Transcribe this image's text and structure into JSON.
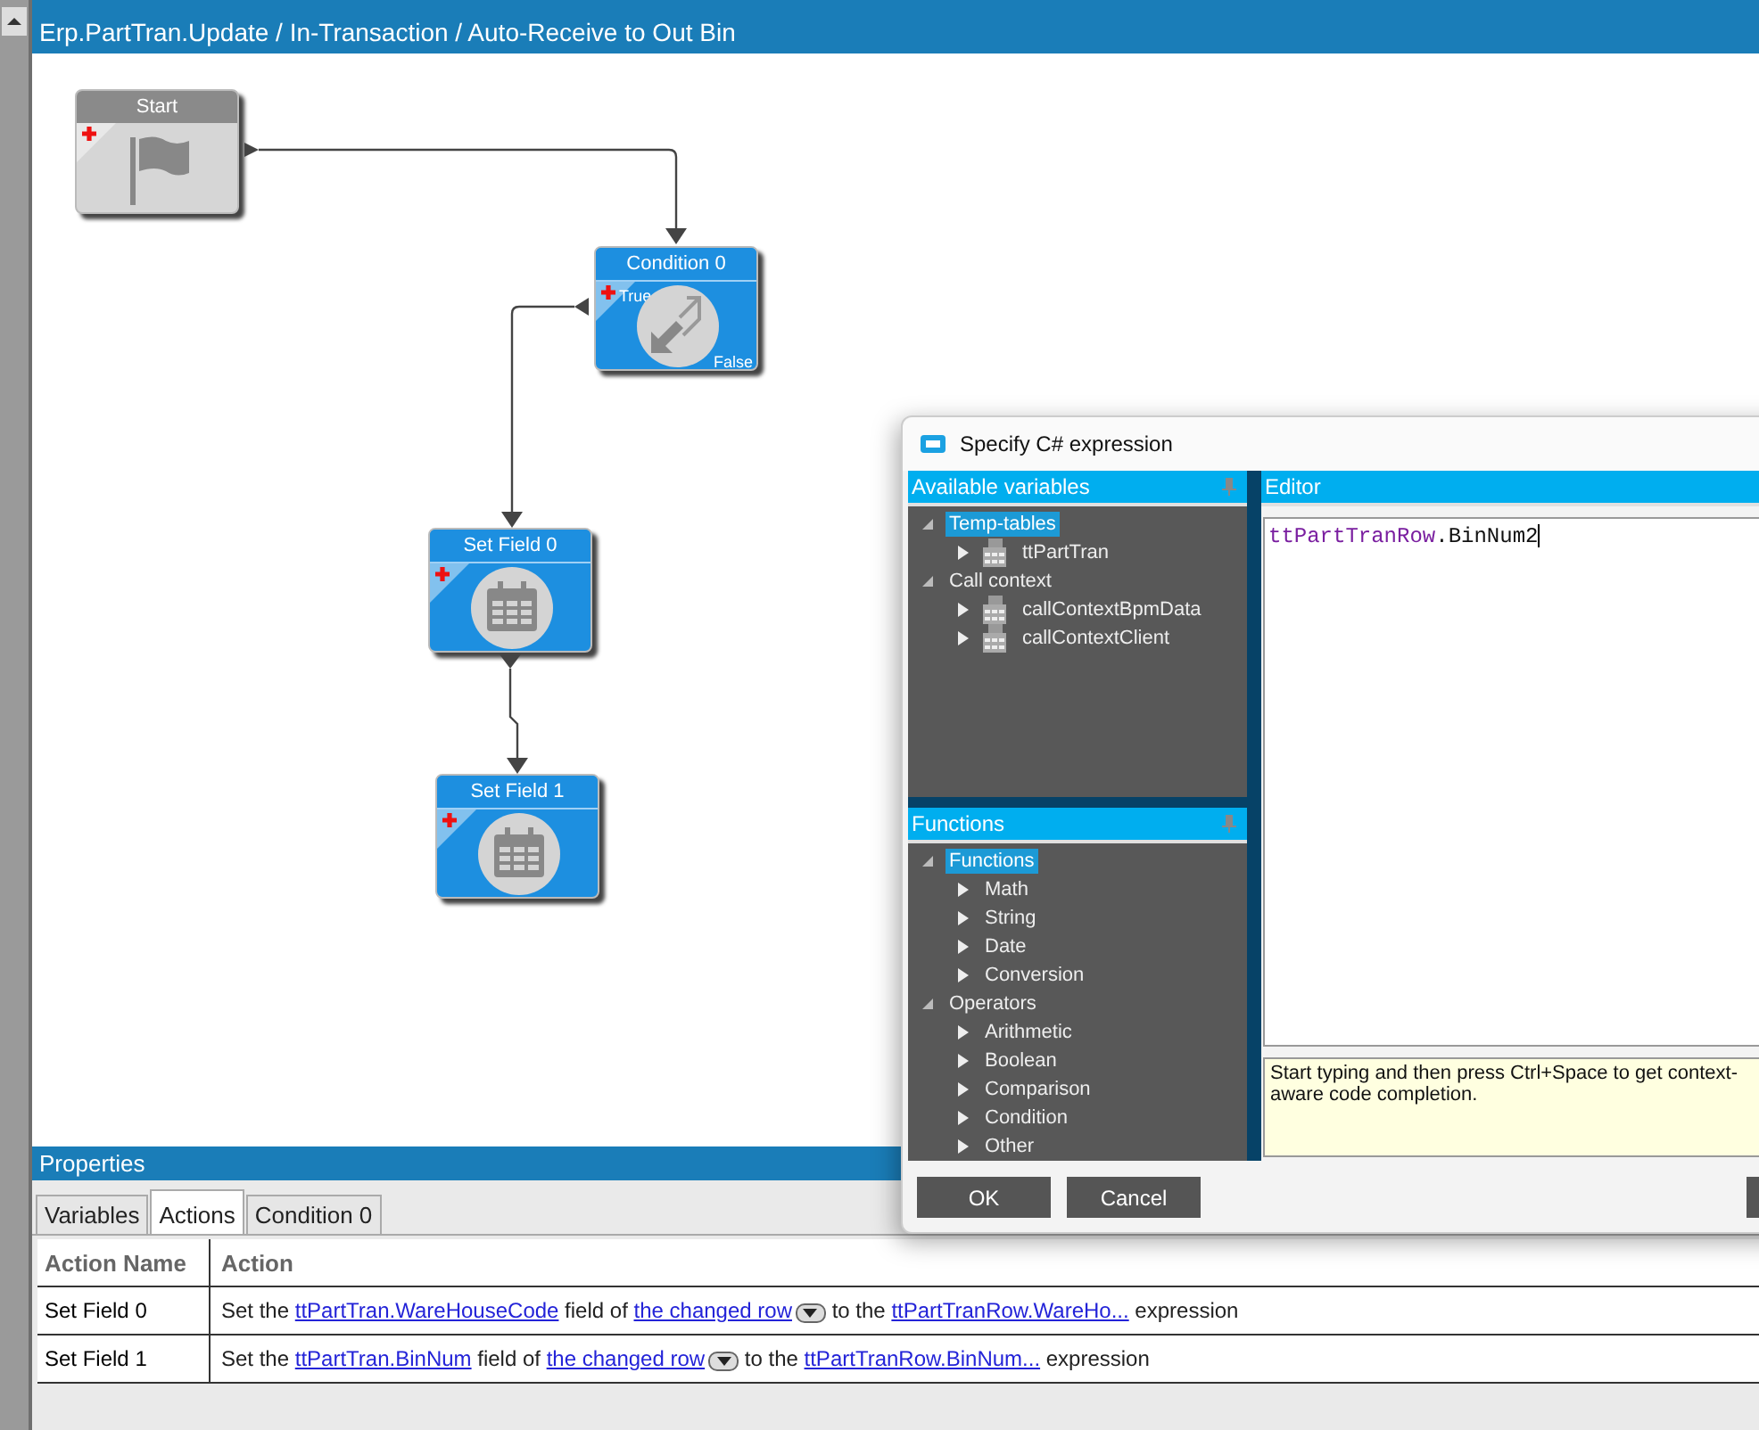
{
  "breadcrumb": "Erp.PartTran.Update / In-Transaction / Auto-Receive to Out Bin",
  "nodes": [
    {
      "kind": "start",
      "title": "Start"
    },
    {
      "kind": "condition",
      "title": "Condition 0",
      "true_label": "True",
      "false_label": "False"
    },
    {
      "kind": "set_field",
      "title": "Set Field 0"
    },
    {
      "kind": "set_field",
      "title": "Set Field 1"
    }
  ],
  "properties": {
    "title": "Properties",
    "tabs": [
      {
        "label": "Variables",
        "selected": false
      },
      {
        "label": "Actions",
        "selected": true
      },
      {
        "label": "Condition 0",
        "selected": false
      }
    ],
    "columns": [
      "Action Name",
      "Action"
    ],
    "rows": [
      {
        "name": "Set Field 0",
        "parts": [
          {
            "kind": "text",
            "text": "Set the "
          },
          {
            "kind": "link",
            "text": "ttPartTran.WareHouseCode"
          },
          {
            "kind": "text",
            "text": " field of "
          },
          {
            "kind": "link",
            "text": "the changed row"
          },
          {
            "kind": "dropdown"
          },
          {
            "kind": "text",
            "text": " to the "
          },
          {
            "kind": "link",
            "text": "ttPartTranRow.WareHo..."
          },
          {
            "kind": "text",
            "text": " expression"
          }
        ]
      },
      {
        "name": "Set Field 1",
        "parts": [
          {
            "kind": "text",
            "text": "Set the "
          },
          {
            "kind": "link",
            "text": "ttPartTran.BinNum"
          },
          {
            "kind": "text",
            "text": " field of "
          },
          {
            "kind": "link",
            "text": "the changed row"
          },
          {
            "kind": "dropdown"
          },
          {
            "kind": "text",
            "text": " to the "
          },
          {
            "kind": "link",
            "text": "ttPartTranRow.BinNum..."
          },
          {
            "kind": "text",
            "text": " expression"
          }
        ]
      }
    ]
  },
  "dialog": {
    "title": "Specify C# expression",
    "variables": {
      "title": "Available variables",
      "tree": [
        {
          "label": "Temp-tables",
          "expanded": true,
          "selected": true,
          "children": [
            {
              "label": "ttPartTran",
              "kind": "table",
              "expanded": false,
              "selected": false
            }
          ]
        },
        {
          "label": "Call context",
          "expanded": true,
          "selected": false,
          "children": [
            {
              "label": "callContextBpmData",
              "kind": "table",
              "expanded": false,
              "selected": false
            },
            {
              "label": "callContextClient",
              "kind": "table",
              "expanded": false,
              "selected": false
            }
          ]
        }
      ]
    },
    "functions": {
      "title": "Functions",
      "tree": [
        {
          "label": "Functions",
          "expanded": true,
          "selected": true,
          "children": [
            {
              "label": "Math",
              "expanded": false,
              "selected": false
            },
            {
              "label": "String",
              "expanded": false,
              "selected": false
            },
            {
              "label": "Date",
              "expanded": false,
              "selected": false
            },
            {
              "label": "Conversion",
              "expanded": false,
              "selected": false
            }
          ]
        },
        {
          "label": "Operators",
          "expanded": true,
          "selected": false,
          "children": [
            {
              "label": "Arithmetic",
              "expanded": false,
              "selected": false
            },
            {
              "label": "Boolean",
              "expanded": false,
              "selected": false
            },
            {
              "label": "Comparison",
              "expanded": false,
              "selected": false
            },
            {
              "label": "Condition",
              "expanded": false,
              "selected": false
            },
            {
              "label": "Other",
              "expanded": false,
              "selected": false
            }
          ]
        }
      ]
    },
    "editor": {
      "title": "Editor",
      "code": [
        {
          "kind": "identifier",
          "text": "ttPartTranRow"
        },
        {
          "kind": "member",
          "text": ".BinNum2"
        }
      ]
    },
    "hint": "Start typing and then press Ctrl+Space to get context-aware code completion.",
    "buttons": [
      "OK",
      "Cancel"
    ]
  }
}
